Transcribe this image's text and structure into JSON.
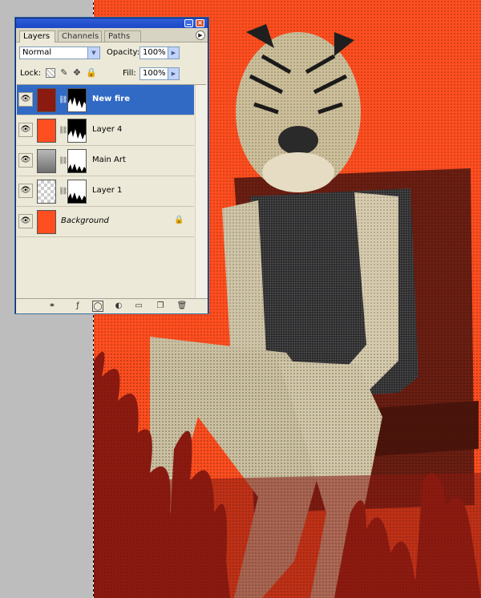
{
  "layers_panel": {
    "tabs": [
      {
        "label": "Layers",
        "active": true
      },
      {
        "label": "Channels",
        "active": false
      },
      {
        "label": "Paths",
        "active": false
      }
    ],
    "blend_mode": "Normal",
    "opacity_label": "Opacity:",
    "opacity_value": "100%",
    "lock_label": "Lock:",
    "fill_label": "Fill:",
    "fill_value": "100%",
    "lock_icons": [
      "lock-transparent-icon",
      "lock-image-icon",
      "lock-position-icon",
      "lock-all-icon"
    ],
    "layers": [
      {
        "name": "New fire",
        "selected": true,
        "thumb_color": "#8b1a10",
        "has_mask": true,
        "italic": false
      },
      {
        "name": "Layer 4",
        "selected": false,
        "thumb_color": "#ff4e1f",
        "has_mask": true,
        "italic": false
      },
      {
        "name": "Main Art",
        "selected": false,
        "thumb_color": "#9a9a9a",
        "has_mask": true,
        "italic": false
      },
      {
        "name": "Layer 1",
        "selected": false,
        "thumb_color": "checker",
        "has_mask": true,
        "italic": false
      },
      {
        "name": "Background",
        "selected": false,
        "thumb_color": "#ff4e1f",
        "has_mask": false,
        "italic": true,
        "locked": true
      }
    ],
    "footer_icons": [
      "link-layers-icon",
      "layer-style-icon",
      "add-mask-icon",
      "adjustment-layer-icon",
      "new-group-icon",
      "new-layer-icon",
      "trash-icon"
    ]
  },
  "colors": {
    "background_orange": "#ff4e1f",
    "fire_dark_red": "#8b1a10",
    "selection_blue": "#316ac5",
    "panel_bg": "#ece9d8"
  },
  "canvas": {
    "description_icon": "tiger-headed-woman-artwork"
  }
}
